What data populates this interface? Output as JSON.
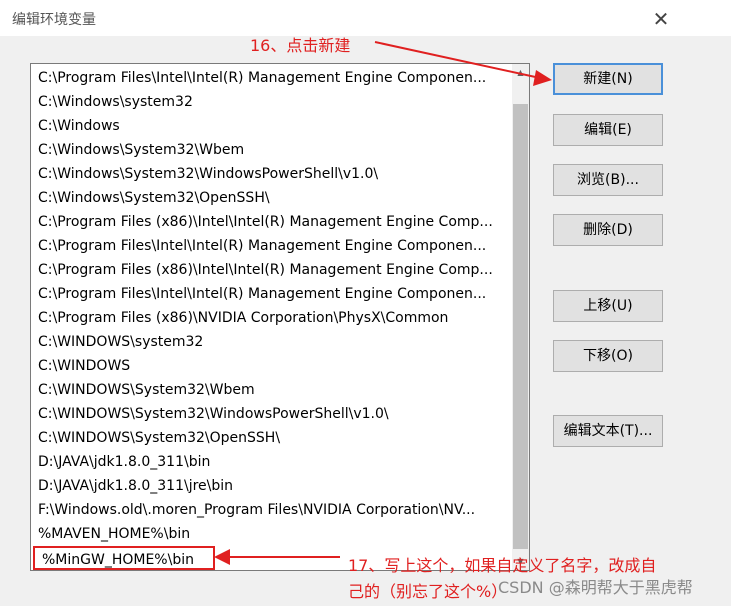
{
  "dialog": {
    "title": "编辑环境变量",
    "close_glyph": "✕"
  },
  "list": {
    "items": [
      "C:\\Program Files\\Intel\\Intel(R) Management Engine Componen...",
      "C:\\Windows\\system32",
      "C:\\Windows",
      "C:\\Windows\\System32\\Wbem",
      "C:\\Windows\\System32\\WindowsPowerShell\\v1.0\\",
      "C:\\Windows\\System32\\OpenSSH\\",
      "C:\\Program Files (x86)\\Intel\\Intel(R) Management Engine Comp...",
      "C:\\Program Files\\Intel\\Intel(R) Management Engine Componen...",
      "C:\\Program Files (x86)\\Intel\\Intel(R) Management Engine Comp...",
      "C:\\Program Files\\Intel\\Intel(R) Management Engine Componen...",
      "C:\\Program Files (x86)\\NVIDIA Corporation\\PhysX\\Common",
      "C:\\WINDOWS\\system32",
      "C:\\WINDOWS",
      "C:\\WINDOWS\\System32\\Wbem",
      "C:\\WINDOWS\\System32\\WindowsPowerShell\\v1.0\\",
      "C:\\WINDOWS\\System32\\OpenSSH\\",
      "D:\\JAVA\\jdk1.8.0_311\\bin",
      "D:\\JAVA\\jdk1.8.0_311\\jre\\bin",
      "F:\\Windows.old\\.moren_Program Files\\NVIDIA Corporation\\NV...",
      "%MAVEN_HOME%\\bin",
      "%MinGW_HOME%\\bin"
    ]
  },
  "buttons": {
    "new": "新建(N)",
    "edit": "编辑(E)",
    "browse": "浏览(B)...",
    "delete": "删除(D)",
    "move_up": "上移(U)",
    "move_down": "下移(O)",
    "edit_text": "编辑文本(T)..."
  },
  "annotations": {
    "step16": "16、点击新建",
    "step17_line1": "17、写上这个，如果自定义了名字，改成自",
    "step17_line2": "己的（别忘了这个%）"
  },
  "watermark": "CSDN @森明帮大于黑虎帮",
  "colors": {
    "annotation": "#e02020",
    "button_focus": "#4a90d9"
  }
}
